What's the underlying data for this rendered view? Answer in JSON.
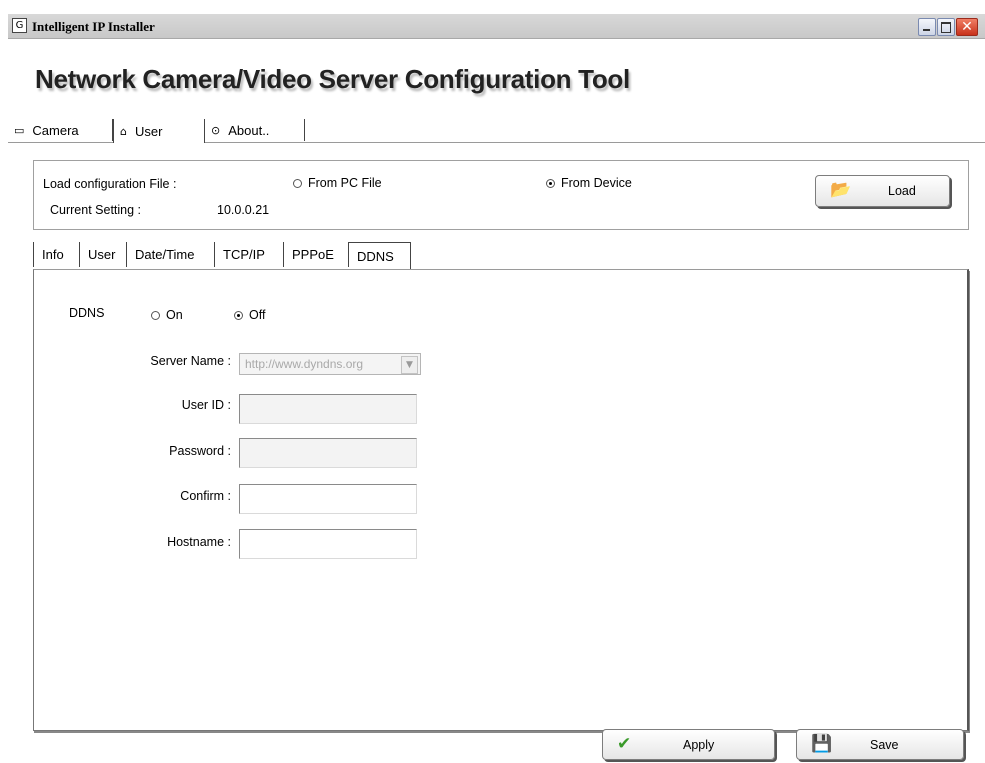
{
  "window": {
    "title": "Intelligent IP Installer",
    "icon_glyph": "G"
  },
  "app": {
    "heading": "Network Camera/Video Server Configuration Tool"
  },
  "main_tabs": [
    {
      "label": "Camera",
      "icon": "camera-icon",
      "glyph": "▭"
    },
    {
      "label": "User",
      "icon": "user-icon",
      "glyph": "⌂"
    },
    {
      "label": "About..",
      "icon": "info-icon",
      "glyph": "⊙"
    }
  ],
  "config": {
    "load_file_label": "Load configuration File :",
    "current_setting_label": "Current Setting :",
    "current_setting_value": "10.0.0.21",
    "from_pc_file": "From PC File",
    "from_device": "From Device",
    "selected_source": "From Device",
    "load_button": "Load"
  },
  "sub_tabs": [
    "Info",
    "User",
    "Date/Time",
    "TCP/IP",
    "PPPoE",
    "DDNS"
  ],
  "active_sub_tab": "DDNS",
  "ddns": {
    "label": "DDNS",
    "on_label": "On",
    "off_label": "Off",
    "selected": "Off",
    "server_name_label": "Server Name :",
    "server_name_value": "http://www.dyndns.org",
    "user_id_label": "User ID :",
    "password_label": "Password :",
    "confirm_label": "Confirm :",
    "hostname_label": "Hostname :"
  },
  "footer": {
    "apply_button": "Apply",
    "save_button": "Save"
  },
  "colors": {
    "checkmark_green": "#3a9a2a",
    "close_button_red": "#c8321b"
  }
}
